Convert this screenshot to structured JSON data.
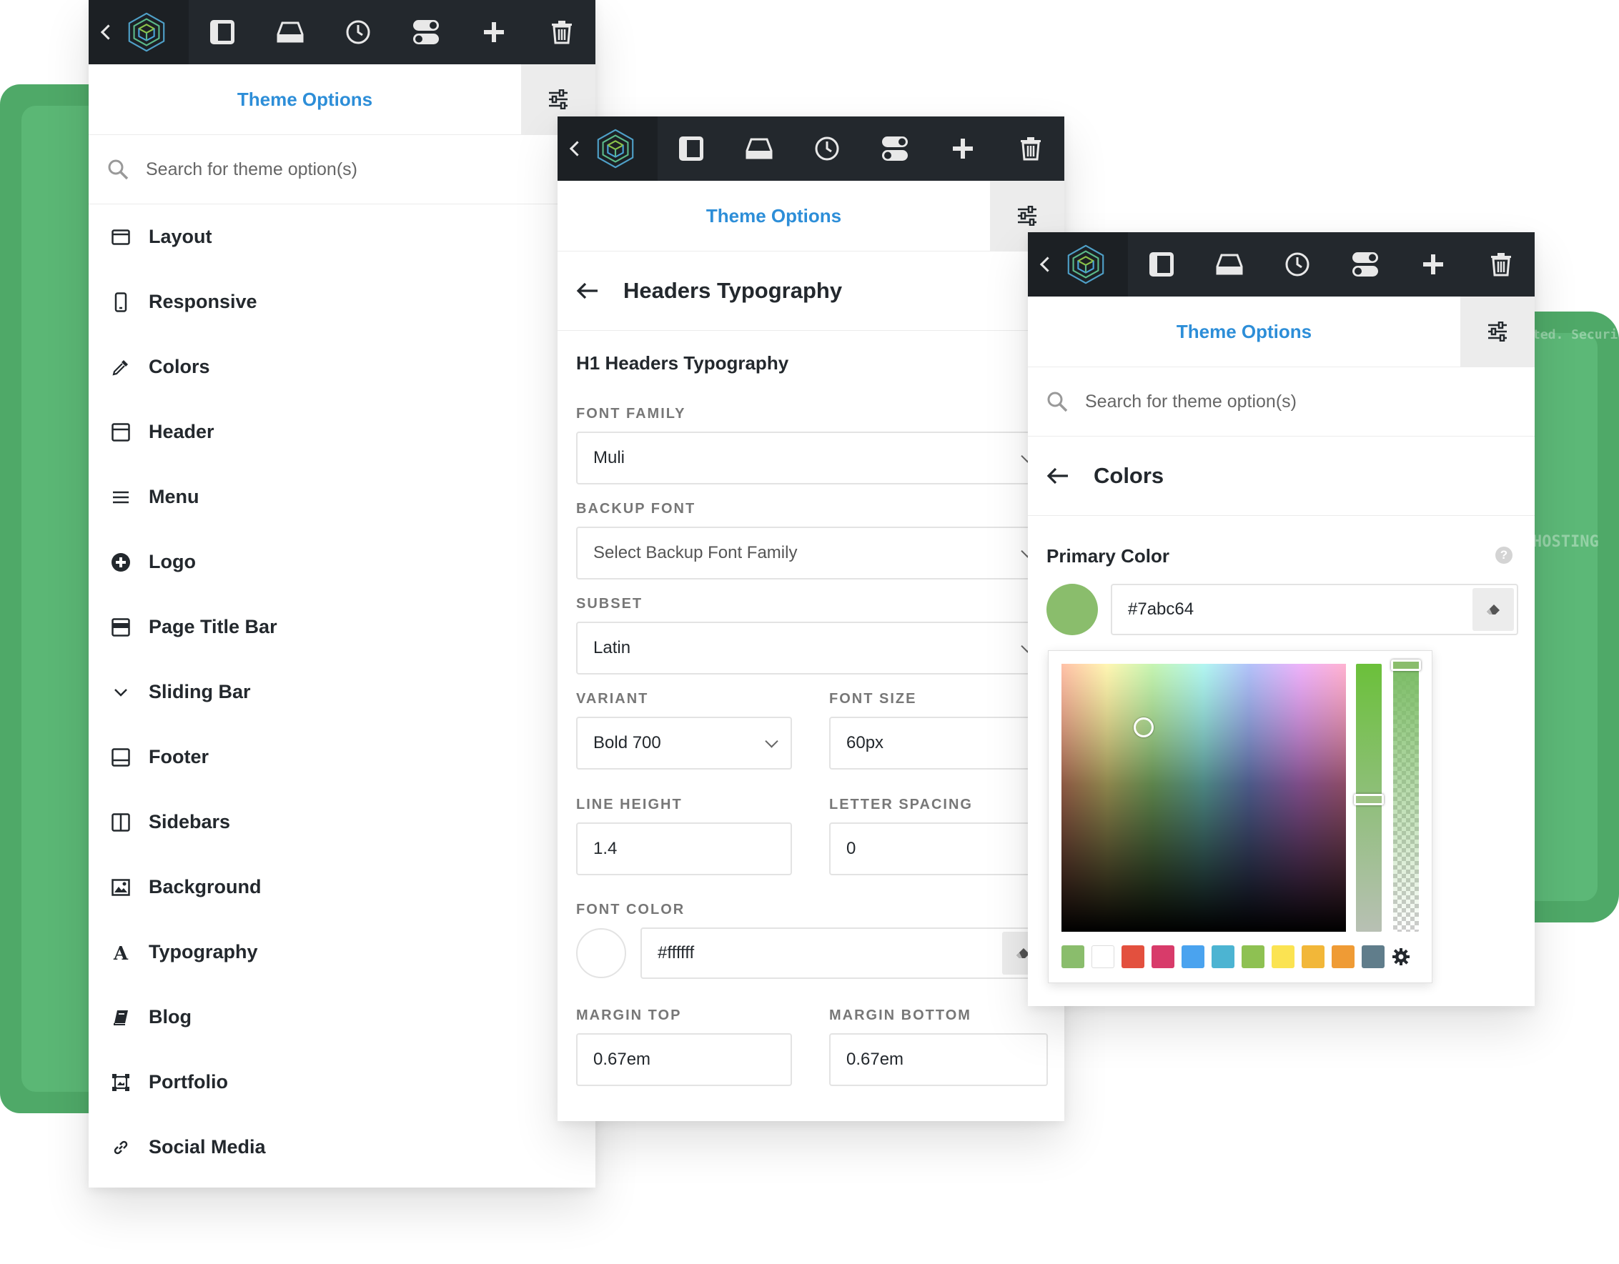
{
  "colors": {
    "toolbar": "#23282d",
    "accent_blue": "#2d8ed8",
    "green": "#4fa968",
    "primary_color": "#7abc64"
  },
  "toolbar": {
    "back_icon": "chevron-left-icon",
    "logo": "avada-cube-logo",
    "icons": [
      "sidebar-icon",
      "drive-icon",
      "clock-icon",
      "toggles-icon",
      "plus-icon",
      "trash-icon"
    ]
  },
  "panel1": {
    "title": "Theme Options",
    "search_placeholder": "Search for theme option(s)",
    "menu": [
      {
        "label": "Layout",
        "icon": "layout-icon"
      },
      {
        "label": "Responsive",
        "icon": "mobile-icon"
      },
      {
        "label": "Colors",
        "icon": "eyedropper-icon"
      },
      {
        "label": "Header",
        "icon": "header-icon"
      },
      {
        "label": "Menu",
        "icon": "hamburger-icon"
      },
      {
        "label": "Logo",
        "icon": "plus-circle-icon"
      },
      {
        "label": "Page Title Bar",
        "icon": "title-bar-icon"
      },
      {
        "label": "Sliding Bar",
        "icon": "chevron-down-icon"
      },
      {
        "label": "Footer",
        "icon": "footer-icon"
      },
      {
        "label": "Sidebars",
        "icon": "sidebars-icon"
      },
      {
        "label": "Background",
        "icon": "image-icon"
      },
      {
        "label": "Typography",
        "icon": "letter-a-icon"
      },
      {
        "label": "Blog",
        "icon": "book-icon"
      },
      {
        "label": "Portfolio",
        "icon": "portfolio-icon"
      },
      {
        "label": "Social Media",
        "icon": "link-icon"
      }
    ]
  },
  "panel2": {
    "title": "Theme Options",
    "back_title": "Headers Typography",
    "section_title": "H1 Headers Typography",
    "font_family": {
      "label": "FONT FAMILY",
      "value": "Muli"
    },
    "backup_font": {
      "label": "BACKUP FONT",
      "placeholder": "Select Backup Font Family"
    },
    "subset": {
      "label": "SUBSET",
      "value": "Latin"
    },
    "variant": {
      "label": "VARIANT",
      "value": "Bold 700"
    },
    "font_size": {
      "label": "FONT SIZE",
      "value": "60px"
    },
    "line_height": {
      "label": "LINE HEIGHT",
      "value": "1.4"
    },
    "letter_spacing": {
      "label": "LETTER SPACING",
      "value": "0"
    },
    "font_color": {
      "label": "FONT COLOR",
      "value": "#ffffff"
    },
    "margin_top": {
      "label": "MARGIN TOP",
      "value": "0.67em"
    },
    "margin_bottom": {
      "label": "MARGIN BOTTOM",
      "value": "0.67em"
    }
  },
  "panel3": {
    "title": "Theme Options",
    "search_placeholder": "Search for theme option(s)",
    "back_title": "Colors",
    "primary_color": {
      "label": "Primary Color",
      "value": "#7abc64",
      "help": "?"
    },
    "palette": [
      "#7abc64",
      "#ffffff",
      "#e3503e",
      "#d83b6a",
      "#4aa3ef",
      "#4cb4d2",
      "#8ec152",
      "#fbe352",
      "#f2b739",
      "#ef9b35",
      "#607d8b"
    ],
    "settings_icon": "gear-icon"
  },
  "background_text": {
    "right_1": "ted. Security",
    "right_2": "HOSTING"
  }
}
